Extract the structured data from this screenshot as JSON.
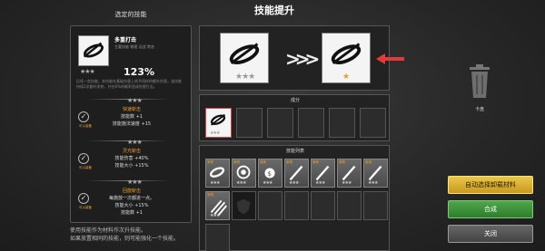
{
  "title": "技能提升",
  "left_panel": {
    "title": "选定的技能",
    "skill": {
      "name": "多重打击",
      "tags": "主要技能 物理 远战 常态",
      "stars": "★★★",
      "percent": "123%",
      "description": "后续一些技能。本技能在基础伤害上给予同样的额外伤害，该技能持续2次额外发射，并在6%的概率造成伤害打击。"
    },
    "tiers": [
      {
        "stars": "★★★",
        "name": "快速斩击",
        "lines": [
          "技能数 +1",
          "技能施法速度 +15"
        ],
        "check_label": "可以装备"
      },
      {
        "stars": "★★★",
        "name": "灵光斩击",
        "lines": [
          "技能伤害 +40%",
          "技能大小 +15%"
        ],
        "check_label": "可以装备"
      },
      {
        "stars": "★★★",
        "name": "回旋斩击",
        "lines": [
          "每施放一次都进一点。",
          "技能大小 +15%",
          "技能数 +1"
        ],
        "check_label": "可以装备"
      }
    ],
    "bottom_note": [
      "使用技能作为材料作次升技能。",
      "如果放置相同的技能，则可能强化一个技能。"
    ]
  },
  "upgrade": {
    "from_stars": "★★★",
    "to_stars": "★"
  },
  "ingredients": {
    "title": "成分",
    "slot1_stars": "★★★"
  },
  "skill_list": {
    "title": "技能列表",
    "items": [
      {
        "tag": "常规",
        "stars": "★★★"
      },
      {
        "tag": "常规",
        "stars": "★★★"
      },
      {
        "tag": "常规",
        "stars": "★★★"
      },
      {
        "tag": "常规",
        "stars": "★★★"
      },
      {
        "tag": "常规",
        "stars": "★★★"
      },
      {
        "tag": "常规",
        "stars": "★★★"
      },
      {
        "tag": "常规",
        "stars": "★★★"
      }
    ],
    "row2": [
      {
        "tag": "常规",
        "stars": "★★★"
      }
    ]
  },
  "trash_label": "卡盘",
  "buttons": {
    "auto": "自动选择卸载材料",
    "combine": "合成",
    "close": "关闭"
  },
  "colors": {
    "accent_orange": "#f0a030",
    "selected_red": "#e04040",
    "btn_yellow": "#d4aa2e",
    "btn_green": "#3e9239"
  }
}
